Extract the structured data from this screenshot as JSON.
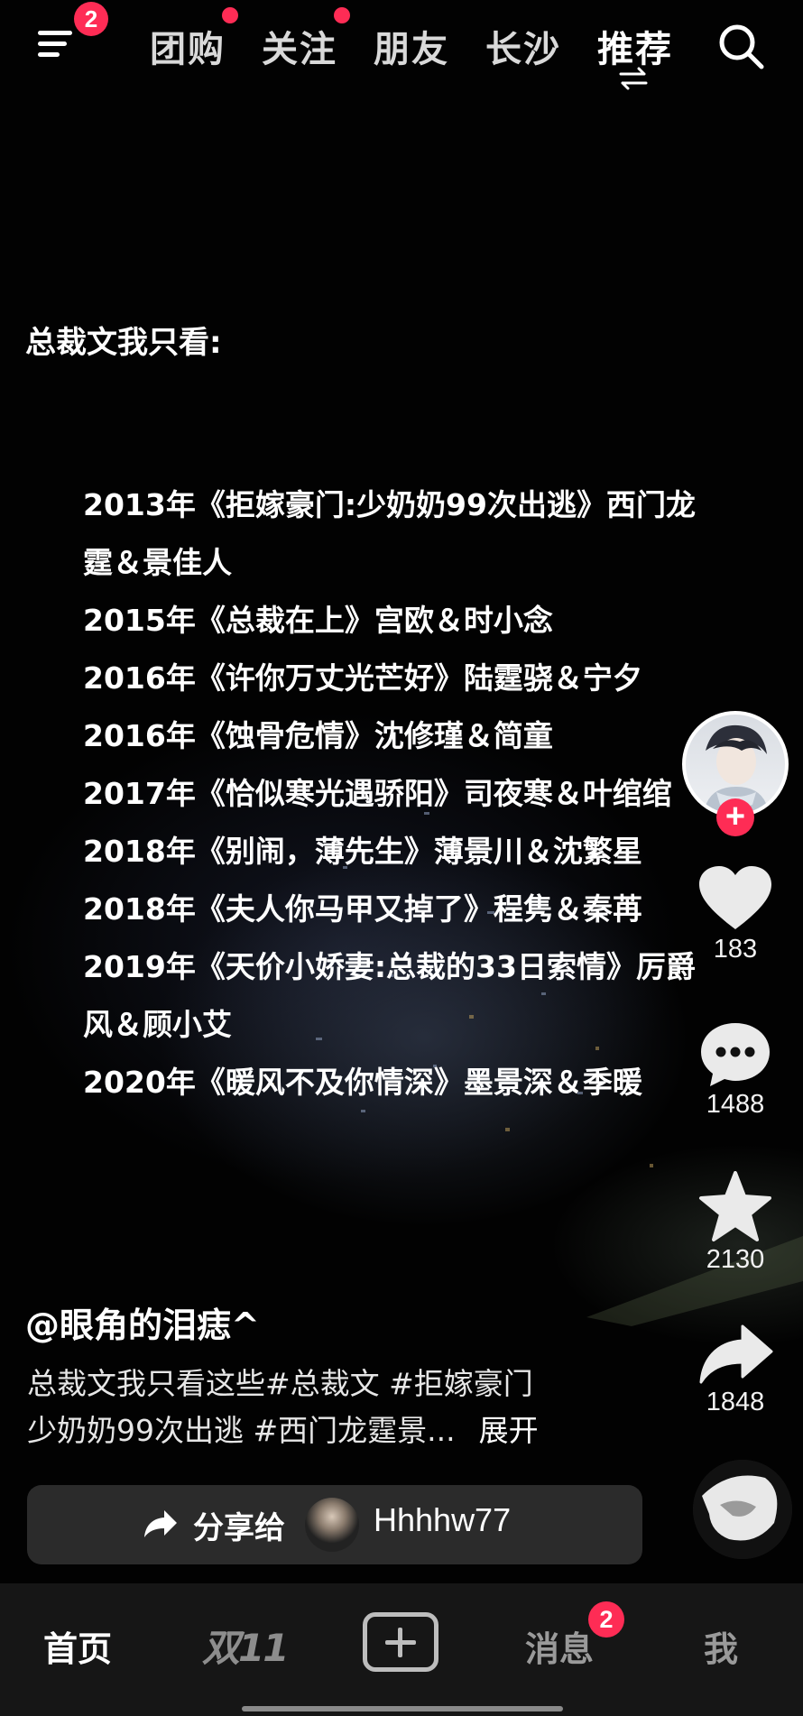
{
  "top_bar": {
    "menu_badge": "2",
    "tabs": [
      {
        "label": "团购",
        "dot": true
      },
      {
        "label": "关注",
        "dot": true
      },
      {
        "label": "朋友",
        "dot": false
      },
      {
        "label": "长沙",
        "dot": false
      },
      {
        "label": "推荐",
        "dot": false,
        "active": true
      }
    ]
  },
  "overlay": {
    "heading": "总裁文我只看:",
    "lines": [
      "2013年《拒嫁豪门:少奶奶99次出逃》西门龙",
      "霆＆景佳人",
      "2015年《总裁在上》宫欧＆时小念",
      "2016年《许你万丈光芒好》陆霆骁＆宁夕",
      "2016年《蚀骨危情》沈修瑾＆简童",
      "2017年《恰似寒光遇骄阳》司夜寒＆叶绾绾",
      "2018年《别闹，薄先生》薄景川＆沈繁星",
      "2018年《夫人你马甲又掉了》程隽＆秦苒",
      "2019年《天价小娇妻:总裁的33日索情》厉爵",
      "风＆顾小艾",
      "2020年《暖风不及你情深》墨景深＆季暖"
    ]
  },
  "rail": {
    "follow_plus": "+",
    "like_count": "183",
    "comment_count": "1488",
    "favorite_count": "2130",
    "share_count": "1848"
  },
  "post": {
    "author": "@眼角的泪痣^",
    "caption_line1": "总裁文我只看这些#总裁文 #拒嫁豪门",
    "caption_line2": "少奶奶99次出逃 #西门龙霆景...",
    "expand": "展开"
  },
  "share_bar": {
    "label": "分享给",
    "username": "Hhhhw77"
  },
  "bottom_nav": {
    "home": "首页",
    "brand": "双11",
    "messages": "消息",
    "messages_badge": "2",
    "me": "我"
  },
  "colors": {
    "accent": "#fe2c55",
    "background": "#000000",
    "nav_background": "#161616"
  }
}
